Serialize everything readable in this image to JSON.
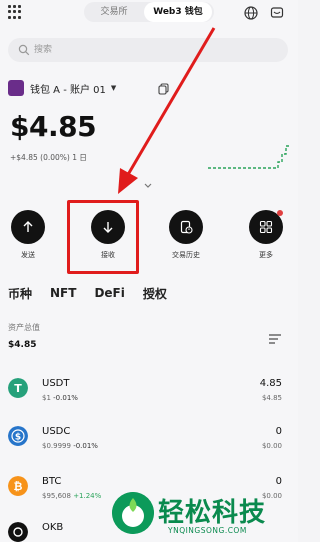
{
  "header": {
    "tab_exchange": "交易所",
    "tab_web3": "Web3 钱包"
  },
  "search": {
    "placeholder": "搜索"
  },
  "account": {
    "name": "钱包 A - 账户 01",
    "caret": "▼"
  },
  "balance": {
    "amount": "$4.85",
    "change": "+$4.85 (0.00%) 1 日"
  },
  "actions": [
    {
      "label": "发送",
      "icon": "arrow-up-icon"
    },
    {
      "label": "接收",
      "icon": "arrow-down-icon"
    },
    {
      "label": "交易历史",
      "icon": "history-icon"
    },
    {
      "label": "更多",
      "icon": "grid-more-icon"
    }
  ],
  "asset_tabs": [
    "币种",
    "NFT",
    "DeFi",
    "授权"
  ],
  "total": {
    "label": "资产总值",
    "value": "$4.85"
  },
  "tokens": [
    {
      "symbol": "USDT",
      "price": "$1",
      "pct": "-0.01%",
      "amount": "4.85",
      "value": "$4.85",
      "color": "#26a17b",
      "glyph": "T"
    },
    {
      "symbol": "USDC",
      "price": "$0.9999",
      "pct": "-0.01%",
      "amount": "0",
      "value": "$0.00",
      "color": "#2775ca",
      "glyph": "$"
    },
    {
      "symbol": "BTC",
      "price": "$95,608",
      "pct": "+1.24%",
      "amount": "0",
      "value": "$0.00",
      "color": "#f7931a",
      "glyph": "₿"
    },
    {
      "symbol": "OKB",
      "price": "",
      "pct": "",
      "amount": "0",
      "value": "",
      "color": "#111111",
      "glyph": "✦"
    }
  ],
  "watermark": {
    "brand": "轻松科技",
    "url": "YNQINGSONG.COM"
  },
  "colors": {
    "highlight": "#e01c1c",
    "positive": "#2aa35a",
    "brand_green": "#0a8a4e"
  }
}
